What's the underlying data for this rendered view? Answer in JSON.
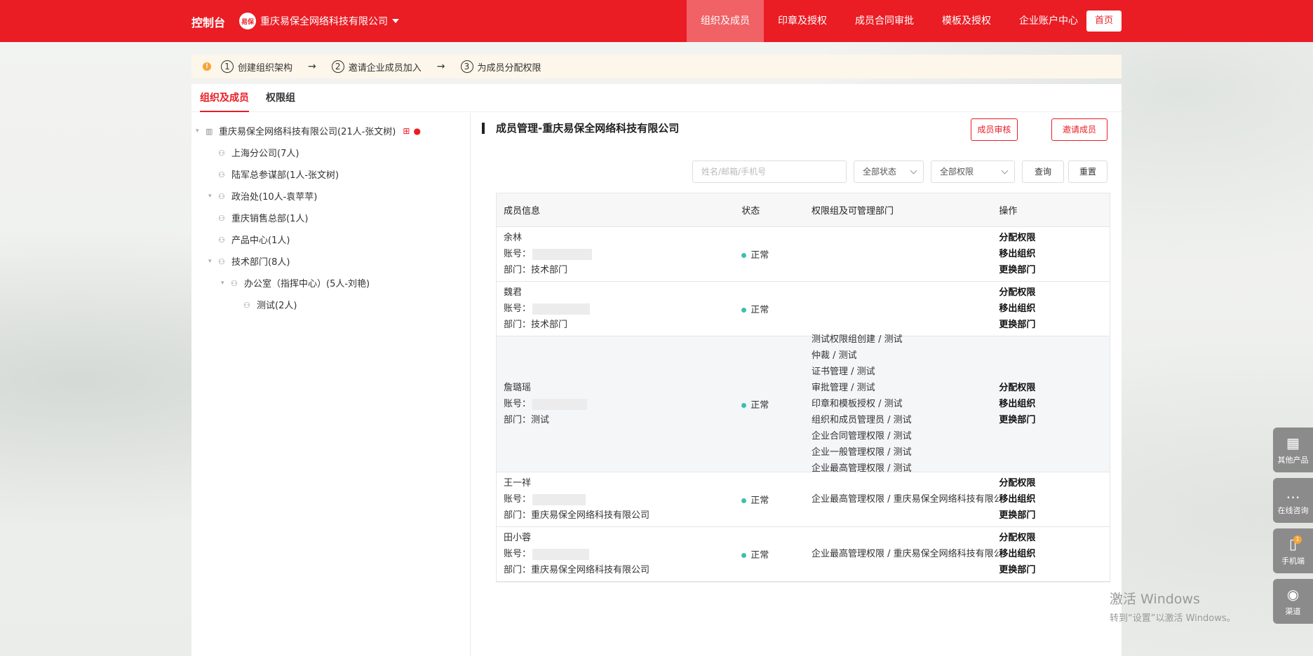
{
  "header": {
    "brand": "控制台",
    "company_logo_text": "易保",
    "company_name": "重庆易保全网络科技有限公司",
    "nav": [
      "组织及成员",
      "印章及授权",
      "成员合同审批",
      "模板及授权",
      "企业账户中心"
    ],
    "home": "首页"
  },
  "steps": {
    "warn_icon": "!",
    "items": [
      {
        "num": "1",
        "label": "创建组织架构"
      },
      {
        "num": "2",
        "label": "邀请企业成员加入"
      },
      {
        "num": "3",
        "label": "为成员分配权限"
      }
    ]
  },
  "tabs": [
    "组织及成员",
    "权限组"
  ],
  "tree": [
    {
      "label": "重庆易保全网络科技有限公司(21人-张文树)",
      "level": 0,
      "toggle": "▾"
    },
    {
      "label": "上海分公司(7人)",
      "level": 1,
      "toggle": ""
    },
    {
      "label": "陆军总参谋部(1人-张文树)",
      "level": 1,
      "toggle": ""
    },
    {
      "label": "政治处(10人-袁苹苹)",
      "level": 1,
      "toggle": "▾"
    },
    {
      "label": "重庆销售总部(1人)",
      "level": 2,
      "toggle": ""
    },
    {
      "label": "产品中心(1人)",
      "level": 2,
      "toggle": ""
    },
    {
      "label": "技术部门(8人)",
      "level": 2,
      "toggle": "▾"
    },
    {
      "label": "办公室（指挥中心）(5人-刘艳)",
      "level": 3,
      "toggle": "▾"
    },
    {
      "label": "测试(2人)",
      "level": 4,
      "toggle": ""
    }
  ],
  "panel": {
    "title": "成员管理-重庆易保全网络科技有限公司",
    "review_btn": "成员审核",
    "invite_btn": "邀请成员",
    "search_placeholder": "姓名/邮箱/手机号",
    "status_filter": "全部状态",
    "perm_filter": "全部权限",
    "query_btn": "查询",
    "reset_btn": "重置"
  },
  "table": {
    "headers": [
      "成员信息",
      "状态",
      "权限组及可管理部门",
      "操作"
    ],
    "account_label": "账号：",
    "dept_label": "部门：",
    "ops": [
      "分配权限",
      "移出组织",
      "更换部门"
    ],
    "rows": [
      {
        "name": "余林",
        "dept": "技术部门",
        "status": "正常",
        "perms": []
      },
      {
        "name": "魏君",
        "dept": "技术部门",
        "status": "正常",
        "perms": []
      },
      {
        "name": "詹璐瑶",
        "dept": "测试",
        "status": "正常",
        "perms": [
          "测试权限组创建 / 测试",
          "仲裁 / 测试",
          "证书管理 / 测试",
          "审批管理 / 测试",
          "印章和模板授权 / 测试",
          "组织和成员管理员 / 测试",
          "企业合同管理权限 / 测试",
          "企业一般管理权限 / 测试",
          "企业最高管理权限 / 测试"
        ]
      },
      {
        "name": "王一祥",
        "dept": "重庆易保全网络科技有限公司",
        "status": "正常",
        "perms": [
          "企业最高管理权限 / 重庆易保全网络科技有限公司"
        ]
      },
      {
        "name": "田小蓉",
        "dept": "重庆易保全网络科技有限公司",
        "status": "正常",
        "perms": [
          "企业最高管理权限 / 重庆易保全网络科技有限公司"
        ]
      }
    ]
  },
  "side": [
    {
      "label": "其他产品",
      "icon": "▦"
    },
    {
      "label": "在线咨询",
      "icon": "…"
    },
    {
      "label": "手机端",
      "icon": "▯",
      "badge": "1"
    },
    {
      "label": "渠道",
      "icon": "◉"
    }
  ],
  "watermark": {
    "line1": "激活 Windows",
    "line2": "转到“设置”以激活 Windows。"
  }
}
